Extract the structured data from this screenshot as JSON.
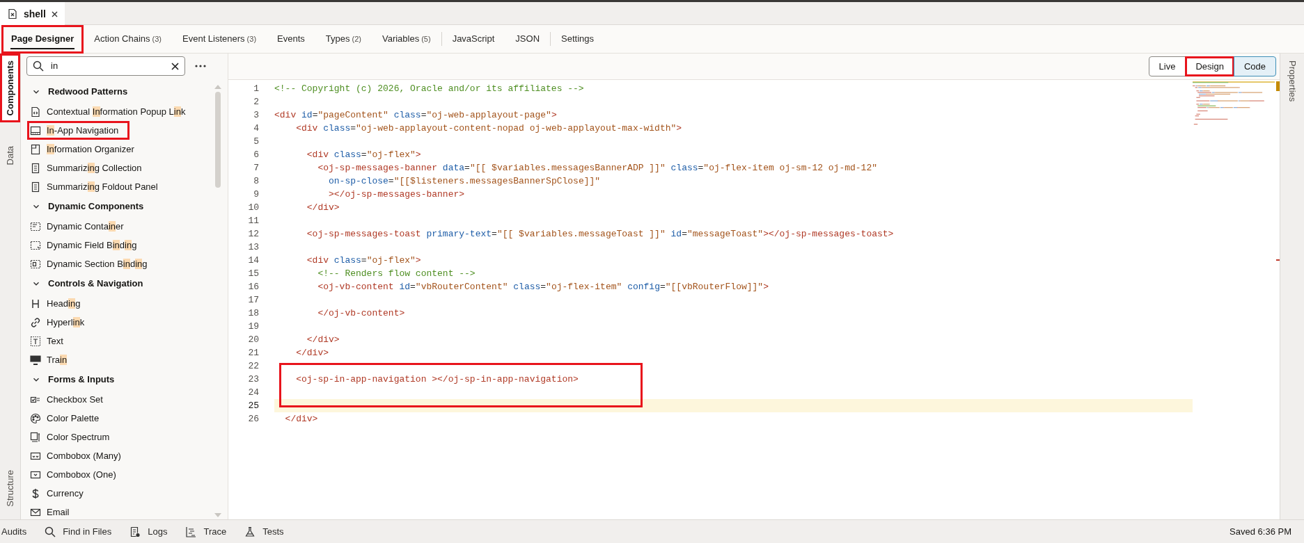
{
  "document_tab": {
    "label": "shell",
    "selected": true
  },
  "tabs": [
    {
      "label": "Page Designer",
      "selected": true,
      "highlighted": true
    },
    {
      "label": "Action Chains",
      "count": "(3)",
      "selected": false,
      "highlighted": false
    },
    {
      "label": "Event Listeners",
      "count": "(3)",
      "selected": false,
      "highlighted": false
    },
    {
      "label": "Events",
      "selected": false,
      "highlighted": false
    },
    {
      "label": "Types",
      "count": "(2)",
      "selected": false,
      "highlighted": false
    },
    {
      "label": "Variables",
      "count": "(5)",
      "selected": false,
      "highlighted": false,
      "separator_after": true
    },
    {
      "label": "JavaScript",
      "selected": false,
      "highlighted": false
    },
    {
      "label": "JSON",
      "selected": false,
      "highlighted": false,
      "separator_after": true
    },
    {
      "label": "Settings",
      "selected": false,
      "highlighted": false
    }
  ],
  "left_rail": {
    "top": [
      {
        "label": "Components",
        "selected": true,
        "highlighted": true
      },
      {
        "label": "Data",
        "selected": false,
        "highlighted": false
      }
    ],
    "bottom": [
      {
        "label": "Structure",
        "selected": false,
        "highlighted": false
      }
    ]
  },
  "search": {
    "value": "in"
  },
  "sections": [
    {
      "title": "Redwood Patterns",
      "expanded": true,
      "items": [
        {
          "highlighted": false,
          "parts": [
            {
              "text": "Contextual ",
              "match": false
            },
            {
              "text": "In",
              "match": true
            },
            {
              "text": "formation Popup L",
              "match": false
            },
            {
              "text": "in",
              "match": true
            },
            {
              "text": "k",
              "match": false
            }
          ]
        },
        {
          "highlighted": true,
          "parts": [
            {
              "text": "In",
              "match": true
            },
            {
              "text": "-App Navigation",
              "match": false
            }
          ]
        },
        {
          "highlighted": false,
          "parts": [
            {
              "text": "In",
              "match": true
            },
            {
              "text": "formation Organizer",
              "match": false
            }
          ]
        },
        {
          "highlighted": false,
          "parts": [
            {
              "text": "Summariz",
              "match": false
            },
            {
              "text": "in",
              "match": true
            },
            {
              "text": "g Collection",
              "match": false
            }
          ]
        },
        {
          "highlighted": false,
          "parts": [
            {
              "text": "Summariz",
              "match": false
            },
            {
              "text": "in",
              "match": true
            },
            {
              "text": "g Foldout Panel",
              "match": false
            }
          ]
        }
      ]
    },
    {
      "title": "Dynamic Components",
      "expanded": true,
      "items": [
        {
          "highlighted": false,
          "parts": [
            {
              "text": "Dynamic Conta",
              "match": false
            },
            {
              "text": "in",
              "match": true
            },
            {
              "text": "er",
              "match": false
            }
          ]
        },
        {
          "highlighted": false,
          "parts": [
            {
              "text": "Dynamic Field B",
              "match": false
            },
            {
              "text": "in",
              "match": true
            },
            {
              "text": "d",
              "match": false
            },
            {
              "text": "in",
              "match": true
            },
            {
              "text": "g",
              "match": false
            }
          ]
        },
        {
          "highlighted": false,
          "parts": [
            {
              "text": "Dynamic Section B",
              "match": false
            },
            {
              "text": "in",
              "match": true
            },
            {
              "text": "d",
              "match": false
            },
            {
              "text": "in",
              "match": true
            },
            {
              "text": "g",
              "match": false
            }
          ]
        }
      ]
    },
    {
      "title": "Controls & Navigation",
      "expanded": true,
      "items": [
        {
          "highlighted": false,
          "parts": [
            {
              "text": "Head",
              "match": false
            },
            {
              "text": "in",
              "match": true
            },
            {
              "text": "g",
              "match": false
            }
          ]
        },
        {
          "highlighted": false,
          "parts": [
            {
              "text": "Hyperl",
              "match": false
            },
            {
              "text": "in",
              "match": true
            },
            {
              "text": "k",
              "match": false
            }
          ]
        },
        {
          "highlighted": false,
          "parts": [
            {
              "text": "Text",
              "match": false
            }
          ]
        },
        {
          "highlighted": false,
          "parts": [
            {
              "text": "Tra",
              "match": false
            },
            {
              "text": "in",
              "match": true
            }
          ]
        }
      ]
    },
    {
      "title": "Forms & Inputs",
      "expanded": true,
      "items": [
        {
          "highlighted": false,
          "parts": [
            {
              "text": "Checkbox Set",
              "match": false
            }
          ]
        },
        {
          "highlighted": false,
          "parts": [
            {
              "text": "Color Palette",
              "match": false
            }
          ]
        },
        {
          "highlighted": false,
          "parts": [
            {
              "text": "Color Spectrum",
              "match": false
            }
          ]
        },
        {
          "highlighted": false,
          "parts": [
            {
              "text": "Combobox (Many)",
              "match": false
            }
          ]
        },
        {
          "highlighted": false,
          "parts": [
            {
              "text": "Combobox (One)",
              "match": false
            }
          ]
        },
        {
          "highlighted": false,
          "parts": [
            {
              "text": "Currency",
              "match": false
            }
          ]
        },
        {
          "highlighted": false,
          "parts": [
            {
              "text": "Email",
              "match": false
            }
          ]
        }
      ]
    }
  ],
  "view_buttons": [
    {
      "label": "Live",
      "selected": false,
      "highlighted": false
    },
    {
      "label": "Design",
      "selected": false,
      "highlighted": true
    },
    {
      "label": "Code",
      "selected": true,
      "highlighted": false
    }
  ],
  "right_rail": [
    {
      "label": "Properties",
      "selected": false
    }
  ],
  "code_lines": [
    {
      "number": "1",
      "current": false,
      "highlighted": false,
      "tokens": [
        {
          "kind": "comment",
          "text": "<!-- Copyright (c) 2026, Oracle and/or its affiliates -->"
        }
      ]
    },
    {
      "number": "2",
      "current": false,
      "highlighted": false
    },
    {
      "number": "3",
      "current": false,
      "highlighted": false,
      "tokens": [
        {
          "kind": "tag",
          "text": "<div"
        },
        {
          "kind": "attr",
          "text": " id"
        },
        {
          "kind": "plain",
          "text": "="
        },
        {
          "kind": "string",
          "text": "\"pageContent\""
        },
        {
          "kind": "attr",
          "text": " class"
        },
        {
          "kind": "plain",
          "text": "="
        },
        {
          "kind": "string",
          "text": "\"oj-web-applayout-page\""
        },
        {
          "kind": "tag",
          "text": ">"
        }
      ]
    },
    {
      "number": "4",
      "current": false,
      "highlighted": false,
      "tokens": [
        {
          "kind": "tag",
          "text": "    <div"
        },
        {
          "kind": "attr",
          "text": " class"
        },
        {
          "kind": "plain",
          "text": "="
        },
        {
          "kind": "string",
          "text": "\"oj-web-applayout-content-nopad oj-web-applayout-max-width\""
        },
        {
          "kind": "tag",
          "text": ">"
        }
      ]
    },
    {
      "number": "5",
      "current": false,
      "highlighted": false
    },
    {
      "number": "6",
      "current": false,
      "highlighted": false,
      "tokens": [
        {
          "kind": "tag",
          "text": "      <div"
        },
        {
          "kind": "attr",
          "text": " class"
        },
        {
          "kind": "plain",
          "text": "="
        },
        {
          "kind": "string",
          "text": "\"oj-flex\""
        },
        {
          "kind": "tag",
          "text": ">"
        }
      ]
    },
    {
      "number": "7",
      "current": false,
      "highlighted": false,
      "tokens": [
        {
          "kind": "tag",
          "text": "        <oj-sp-messages-banner"
        },
        {
          "kind": "attr",
          "text": " data"
        },
        {
          "kind": "plain",
          "text": "="
        },
        {
          "kind": "string",
          "text": "\"[[ $variables.messagesBannerADP ]]\""
        },
        {
          "kind": "attr",
          "text": " class"
        },
        {
          "kind": "plain",
          "text": "="
        },
        {
          "kind": "string",
          "text": "\"oj-flex-item oj-sm-12 oj-md-12\""
        }
      ]
    },
    {
      "number": "8",
      "current": false,
      "highlighted": false,
      "tokens": [
        {
          "kind": "attr",
          "text": "          on-sp-close"
        },
        {
          "kind": "plain",
          "text": "="
        },
        {
          "kind": "string",
          "text": "\"[[$listeners.messagesBannerSpClose]]\""
        }
      ]
    },
    {
      "number": "9",
      "current": false,
      "highlighted": false,
      "tokens": [
        {
          "kind": "tag",
          "text": "          ></oj-sp-messages-banner>"
        }
      ]
    },
    {
      "number": "10",
      "current": false,
      "highlighted": false,
      "tokens": [
        {
          "kind": "tag",
          "text": "      </div>"
        }
      ]
    },
    {
      "number": "11",
      "current": false,
      "highlighted": false
    },
    {
      "number": "12",
      "current": false,
      "highlighted": false,
      "tokens": [
        {
          "kind": "tag",
          "text": "      <oj-sp-messages-toast"
        },
        {
          "kind": "attr",
          "text": " primary-text"
        },
        {
          "kind": "plain",
          "text": "="
        },
        {
          "kind": "string",
          "text": "\"[[ $variables.messageToast ]]\""
        },
        {
          "kind": "attr",
          "text": " id"
        },
        {
          "kind": "plain",
          "text": "="
        },
        {
          "kind": "string",
          "text": "\"messageToast\""
        },
        {
          "kind": "tag",
          "text": "></oj-sp-messages-toast>"
        }
      ]
    },
    {
      "number": "13",
      "current": false,
      "highlighted": false
    },
    {
      "number": "14",
      "current": false,
      "highlighted": false,
      "tokens": [
        {
          "kind": "tag",
          "text": "      <div"
        },
        {
          "kind": "attr",
          "text": " class"
        },
        {
          "kind": "plain",
          "text": "="
        },
        {
          "kind": "string",
          "text": "\"oj-flex\""
        },
        {
          "kind": "tag",
          "text": ">"
        }
      ]
    },
    {
      "number": "15",
      "current": false,
      "highlighted": false,
      "tokens": [
        {
          "kind": "comment",
          "text": "        <!-- Renders flow content -->"
        }
      ]
    },
    {
      "number": "16",
      "current": false,
      "highlighted": false,
      "tokens": [
        {
          "kind": "tag",
          "text": "        <oj-vb-content"
        },
        {
          "kind": "attr",
          "text": " id"
        },
        {
          "kind": "plain",
          "text": "="
        },
        {
          "kind": "string",
          "text": "\"vbRouterContent\""
        },
        {
          "kind": "attr",
          "text": " class"
        },
        {
          "kind": "plain",
          "text": "="
        },
        {
          "kind": "string",
          "text": "\"oj-flex-item\""
        },
        {
          "kind": "attr",
          "text": " config"
        },
        {
          "kind": "plain",
          "text": "="
        },
        {
          "kind": "string",
          "text": "\"[[vbRouterFlow]]\""
        },
        {
          "kind": "tag",
          "text": ">"
        }
      ]
    },
    {
      "number": "17",
      "current": false,
      "highlighted": false
    },
    {
      "number": "18",
      "current": false,
      "highlighted": false,
      "tokens": [
        {
          "kind": "tag",
          "text": "        </oj-vb-content>"
        }
      ]
    },
    {
      "number": "19",
      "current": false,
      "highlighted": false
    },
    {
      "number": "20",
      "current": false,
      "highlighted": false,
      "tokens": [
        {
          "kind": "tag",
          "text": "      </div>"
        }
      ]
    },
    {
      "number": "21",
      "current": false,
      "highlighted": false,
      "tokens": [
        {
          "kind": "tag",
          "text": "    </div>"
        }
      ]
    },
    {
      "number": "22",
      "current": false,
      "highlighted": false
    },
    {
      "number": "23",
      "current": false,
      "highlighted": true,
      "tokens": [
        {
          "kind": "tag",
          "text": "    <oj-sp-in-app-navigation ></oj-sp-in-app-navigation>"
        }
      ]
    },
    {
      "number": "24",
      "current": false,
      "highlighted": true
    },
    {
      "number": "25",
      "current": true,
      "highlighted": true
    },
    {
      "number": "26",
      "current": false,
      "highlighted": false,
      "tokens": [
        {
          "kind": "tag",
          "text": "  </div>"
        }
      ]
    }
  ],
  "status_bar": {
    "items": [
      {
        "label": "Audits",
        "kind": "audits"
      },
      {
        "label": "Find in Files",
        "kind": "search"
      },
      {
        "label": "Logs",
        "kind": "logs"
      },
      {
        "label": "Trace",
        "kind": "trace"
      },
      {
        "label": "Tests",
        "kind": "tests"
      }
    ],
    "saved": "Saved 6:36 PM"
  }
}
